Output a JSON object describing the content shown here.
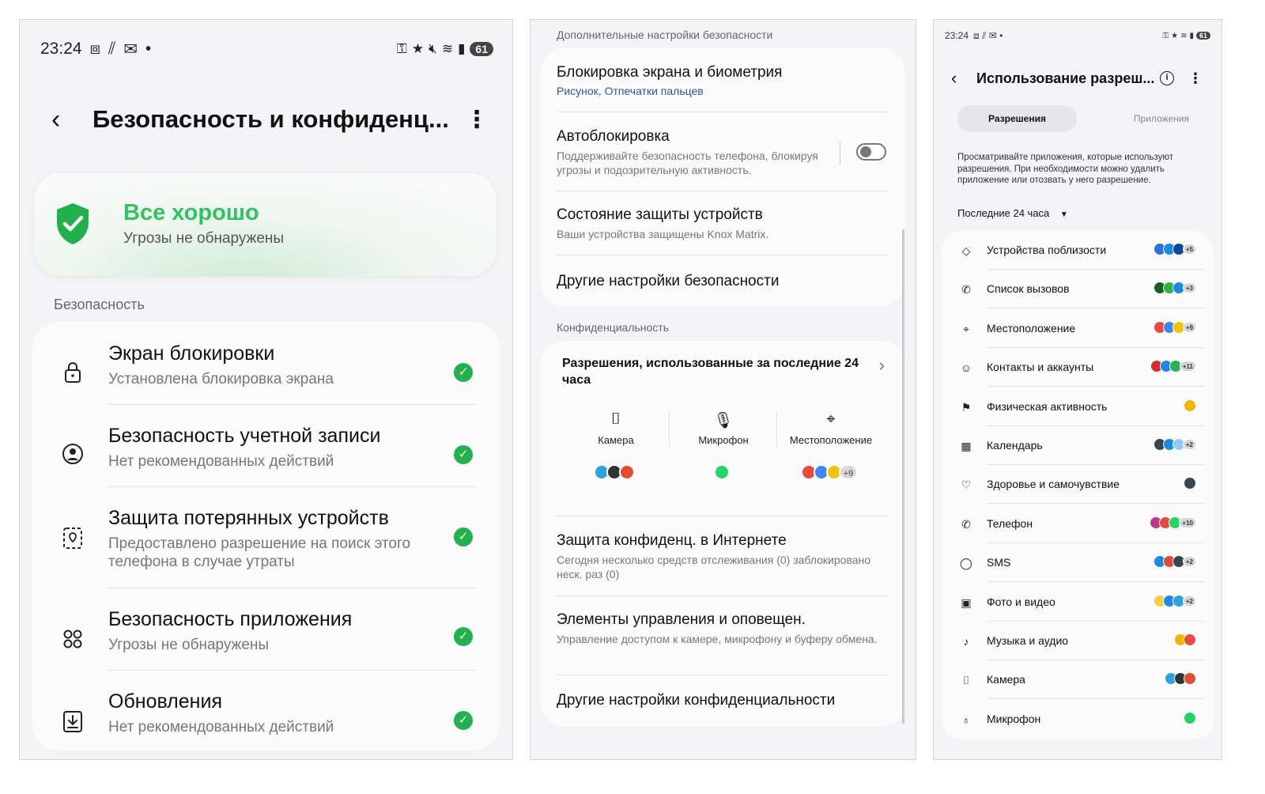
{
  "panel1": {
    "status_bar": {
      "time": "23:24",
      "battery": "61"
    },
    "header": {
      "title": "Безопасность и конфиденц...",
      "back_label": "‹",
      "more_label": "⋮"
    },
    "status_card": {
      "title": "Все хорошо",
      "subtitle": "Угрозы не обнаружены",
      "accent": "#2ec55e"
    },
    "section_label": "Безопасность",
    "items": [
      {
        "title": "Экран блокировки",
        "desc": "Установлена блокировка экрана",
        "icon": "lock-icon"
      },
      {
        "title": "Безопасность учетной записи",
        "desc": "Нет рекомендованных действий",
        "icon": "account-icon"
      },
      {
        "title": "Защита потерянных устройств",
        "desc": "Предоставлено разрешение на поиск этого телефона в случае утраты",
        "icon": "find-device-icon"
      },
      {
        "title": "Безопасность приложения",
        "desc": "Угрозы не обнаружены",
        "icon": "apps-icon"
      },
      {
        "title": "Обновления",
        "desc": "Нет рекомендованных действий",
        "icon": "update-icon"
      }
    ]
  },
  "panel2": {
    "section_security": "Дополнительные настройки безопасности",
    "security_items": [
      {
        "title": "Блокировка экрана и биометрия",
        "desc": "Рисунок, Отпечатки пальцев"
      },
      {
        "title": "Автоблокировка",
        "desc": "Поддерживайте безопасность телефона, блокируя угрозы и подозрительную активность.",
        "toggle": false
      },
      {
        "title": "Состояние защиты устройств",
        "desc": "Ваши устройства защищены Knox Matrix."
      },
      {
        "title": "Другие настройки безопасности"
      }
    ],
    "section_privacy": "Конфиденциальность",
    "permissions_used": {
      "title": "Разрешения, использованные за последние 24 часа",
      "items": [
        {
          "label": "Камера",
          "icon": "camera-icon"
        },
        {
          "label": "Микрофон",
          "icon": "microphone-icon"
        },
        {
          "label": "Местоположение",
          "icon": "location-icon",
          "more": "+9"
        }
      ]
    },
    "privacy_items": [
      {
        "title": "Защита конфиденц. в Интернете",
        "desc": "Сегодня несколько средств отслеживания (0) заблокировано неск. раз (0)"
      },
      {
        "title": "Элементы управления и оповещен.",
        "desc": "Управление доступом к камере, микрофону и буферу обмена."
      },
      {
        "title": "Другие настройки конфиденциальности"
      }
    ]
  },
  "panel3": {
    "status_bar": {
      "time": "23:24",
      "battery": "61"
    },
    "header": {
      "title": "Использование разреш...",
      "info": "i",
      "more": "⋮",
      "back": "‹"
    },
    "tabs": [
      "Разрешения",
      "Приложения"
    ],
    "description": "Просматривайте приложения, которые используют разрешения. При необходимости можно удалить приложение или отозвать у него разрешение.",
    "range": "Последние 24 часа",
    "items": [
      {
        "label": "Устройства поблизости",
        "icon": "nearby-icon",
        "more": "+5"
      },
      {
        "label": "Список вызовов",
        "icon": "call-log-icon",
        "more": "+3"
      },
      {
        "label": "Местоположение",
        "icon": "location-icon",
        "more": "+9"
      },
      {
        "label": "Контакты и аккаунты",
        "icon": "contacts-icon",
        "more": "+11"
      },
      {
        "label": "Физическая активность",
        "icon": "activity-icon",
        "more": ""
      },
      {
        "label": "Календарь",
        "icon": "calendar-icon",
        "more": "+2"
      },
      {
        "label": "Здоровье и самочувствие",
        "icon": "health-icon",
        "more": ""
      },
      {
        "label": "Телефон",
        "icon": "phone-icon",
        "more": "+10"
      },
      {
        "label": "SMS",
        "icon": "sms-icon",
        "more": "+2"
      },
      {
        "label": "Фото и видео",
        "icon": "photo-icon",
        "more": "+2"
      },
      {
        "label": "Музыка и аудио",
        "icon": "music-icon",
        "more": ""
      },
      {
        "label": "Камера",
        "icon": "camera-icon",
        "more": ""
      },
      {
        "label": "Микрофон",
        "icon": "microphone-icon",
        "more": ""
      }
    ]
  }
}
